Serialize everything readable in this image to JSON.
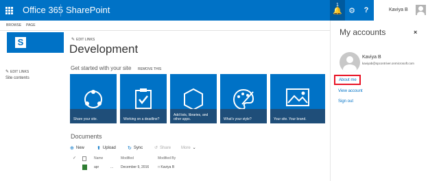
{
  "suite": {
    "brand": "Office 365",
    "app": "SharePoint",
    "notification_count": "1",
    "help_label": "?",
    "user_name": "Kaviya B"
  },
  "ribbon": {
    "tabs": [
      "BROWSE",
      "PAGE"
    ]
  },
  "site": {
    "edit_links": "EDIT LINKS",
    "title": "Development",
    "left_nav": {
      "edit_links": "EDIT LINKS",
      "site_contents": "Site contents"
    }
  },
  "get_started": {
    "heading": "Get started with your site",
    "remove": "REMOVE THIS",
    "tiles": [
      {
        "caption": "Share your site."
      },
      {
        "caption": "Working on a deadline?"
      },
      {
        "caption": "Add lists, libraries, and other apps."
      },
      {
        "caption": "What's your style?"
      },
      {
        "caption": "Your site. Your brand."
      }
    ]
  },
  "documents": {
    "title": "Documents",
    "toolbar": {
      "new": "New",
      "upload": "Upload",
      "sync": "Sync",
      "share": "Share",
      "more": "More"
    },
    "columns": {
      "name": "Name",
      "modified": "Modified",
      "modified_by": "Modified By"
    },
    "rows": [
      {
        "name": "apr",
        "ellipsis": "...",
        "modified": "December 9, 2016",
        "modified_by": "Kaviya B"
      }
    ]
  },
  "panel": {
    "title": "My accounts",
    "close": "×",
    "name": "Kaviya B",
    "email": "kaviyab@spcontriver.onmicrosoft.com",
    "about_me": "About me",
    "view_account": "View account",
    "sign_out": "Sign out"
  },
  "colors": {
    "accent": "#0072c6",
    "tile_caption": "#1f4e79",
    "highlight": "#e81123"
  }
}
